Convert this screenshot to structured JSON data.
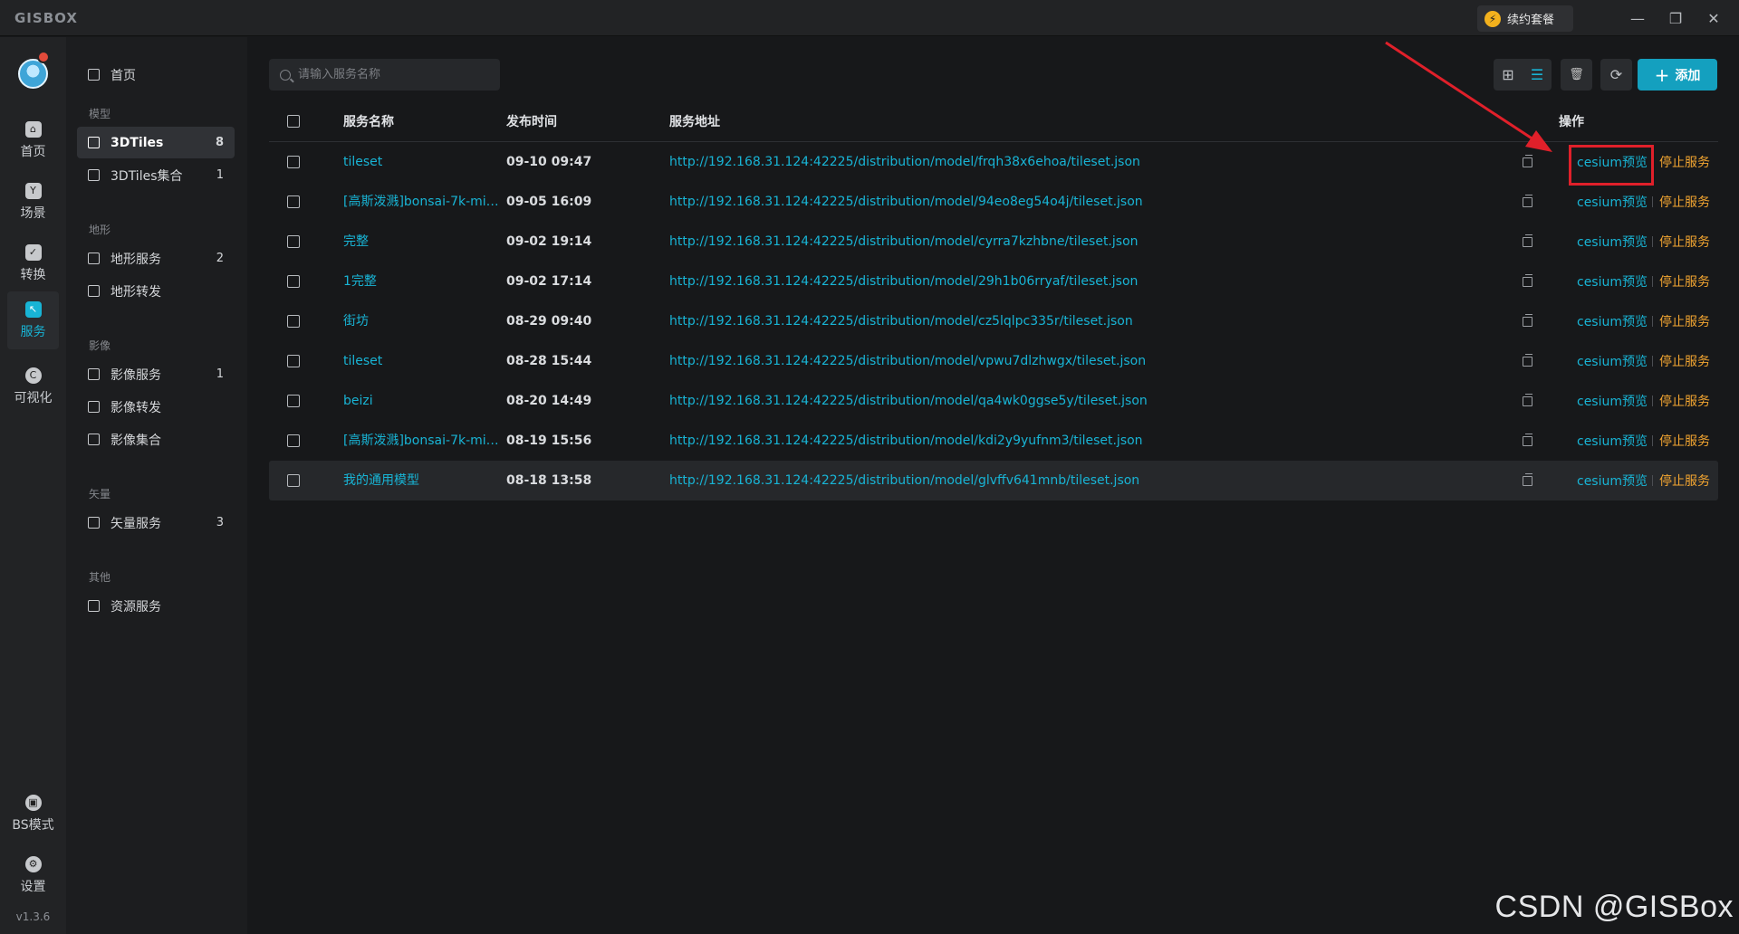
{
  "app": {
    "logo": "GISBOX",
    "renew_label": "续约套餐"
  },
  "window": {
    "minimize_glyph": "—",
    "restore_glyph": "❐",
    "close_glyph": "✕"
  },
  "rail": {
    "items": [
      {
        "label": "首页",
        "icon": "home-icon"
      },
      {
        "label": "场景",
        "icon": "scene-icon"
      },
      {
        "label": "转换",
        "icon": "convert-icon"
      },
      {
        "label": "服务",
        "icon": "service-icon",
        "active": true
      },
      {
        "label": "可视化",
        "icon": "visualize-icon"
      }
    ],
    "bottom": [
      {
        "label": "BS模式",
        "icon": "lock-icon"
      },
      {
        "label": "设置",
        "icon": "gear-icon"
      }
    ],
    "version": "v1.3.6"
  },
  "subnav": {
    "home": "首页",
    "groups": [
      {
        "label": "模型",
        "items": [
          {
            "label": "3DTiles",
            "count": "8",
            "active": true
          },
          {
            "label": "3DTiles集合",
            "count": "1"
          }
        ]
      },
      {
        "label": "地形",
        "items": [
          {
            "label": "地形服务",
            "count": "2"
          },
          {
            "label": "地形转发",
            "count": ""
          }
        ]
      },
      {
        "label": "影像",
        "items": [
          {
            "label": "影像服务",
            "count": "1"
          },
          {
            "label": "影像转发",
            "count": ""
          },
          {
            "label": "影像集合",
            "count": ""
          }
        ]
      },
      {
        "label": "矢量",
        "items": [
          {
            "label": "矢量服务",
            "count": "3"
          }
        ]
      },
      {
        "label": "其他",
        "items": [
          {
            "label": "资源服务",
            "count": ""
          }
        ]
      }
    ]
  },
  "toolbar": {
    "search_placeholder": "请输入服务名称",
    "add_label": "添加",
    "add_glyph": "+",
    "grid_glyph": "⊞",
    "list_glyph": "☰",
    "delete_glyph": "🗑",
    "refresh_glyph": "⟳"
  },
  "table": {
    "headers": {
      "name": "服务名称",
      "time": "发布时间",
      "url": "服务地址",
      "actions": "操作"
    },
    "rows": [
      {
        "name": "tileset",
        "time": "09-10 09:47",
        "url": "http://192.168.31.124:42225/distribution/model/frqh38x6ehoa/tileset.json",
        "preview": "cesium预览",
        "stop": "停止服务"
      },
      {
        "name": "[高斯泼溅]bonsai-7k-mini-…",
        "time": "09-05 16:09",
        "url": "http://192.168.31.124:42225/distribution/model/94eo8eg54o4j/tileset.json",
        "preview": "cesium预览",
        "stop": "停止服务"
      },
      {
        "name": "完整",
        "time": "09-02 19:14",
        "url": "http://192.168.31.124:42225/distribution/model/cyrra7kzhbne/tileset.json",
        "preview": "cesium预览",
        "stop": "停止服务"
      },
      {
        "name": "1完整",
        "time": "09-02 17:14",
        "url": "http://192.168.31.124:42225/distribution/model/29h1b06rryaf/tileset.json",
        "preview": "cesium预览",
        "stop": "停止服务"
      },
      {
        "name": "街坊",
        "time": "08-29 09:40",
        "url": "http://192.168.31.124:42225/distribution/model/cz5lqlpc335r/tileset.json",
        "preview": "cesium预览",
        "stop": "停止服务"
      },
      {
        "name": "tileset",
        "time": "08-28 15:44",
        "url": "http://192.168.31.124:42225/distribution/model/vpwu7dlzhwgx/tileset.json",
        "preview": "cesium预览",
        "stop": "停止服务"
      },
      {
        "name": "beizi",
        "time": "08-20 14:49",
        "url": "http://192.168.31.124:42225/distribution/model/qa4wk0ggse5y/tileset.json",
        "preview": "cesium预览",
        "stop": "停止服务"
      },
      {
        "name": "[高斯泼溅]bonsai-7k-mini-…",
        "time": "08-19 15:56",
        "url": "http://192.168.31.124:42225/distribution/model/kdi2y9yufnm3/tileset.json",
        "preview": "cesium预览",
        "stop": "停止服务"
      },
      {
        "name": "我的通用模型",
        "time": "08-18 13:58",
        "url": "http://192.168.31.124:42225/distribution/model/glvffv641mnb/tileset.json",
        "preview": "cesium预览",
        "stop": "停止服务"
      }
    ]
  },
  "watermark": "CSDN @GISBox",
  "colors": {
    "accent": "#18b4d5",
    "stop": "#f2a531",
    "annotation": "#e0202a",
    "add_button": "#14a0bf"
  }
}
